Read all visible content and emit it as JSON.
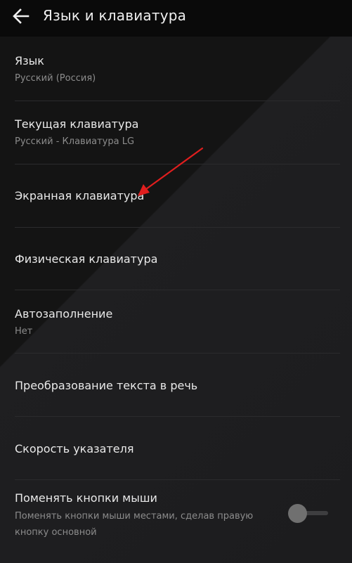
{
  "header": {
    "title": "Язык и клавиатура",
    "back_icon": "arrow-left-icon"
  },
  "items": [
    {
      "title": "Язык",
      "subtitle": "Русский (Россия)"
    },
    {
      "title": "Текущая клавиатура",
      "subtitle": "Русский - Клавиатура LG"
    },
    {
      "title": "Экранная клавиатура"
    },
    {
      "title": "Физическая клавиатура"
    },
    {
      "title": "Автозаполнение",
      "subtitle": "Нет"
    },
    {
      "title": "Преобразование текста в речь"
    },
    {
      "title": "Скорость указателя"
    },
    {
      "title": "Поменять кнопки мыши",
      "subtitle": "Поменять кнопки мыши местами, сделав правую кнопку основной",
      "toggle_on": false
    }
  ],
  "annotation": {
    "arrow_color": "#e01e1e"
  }
}
